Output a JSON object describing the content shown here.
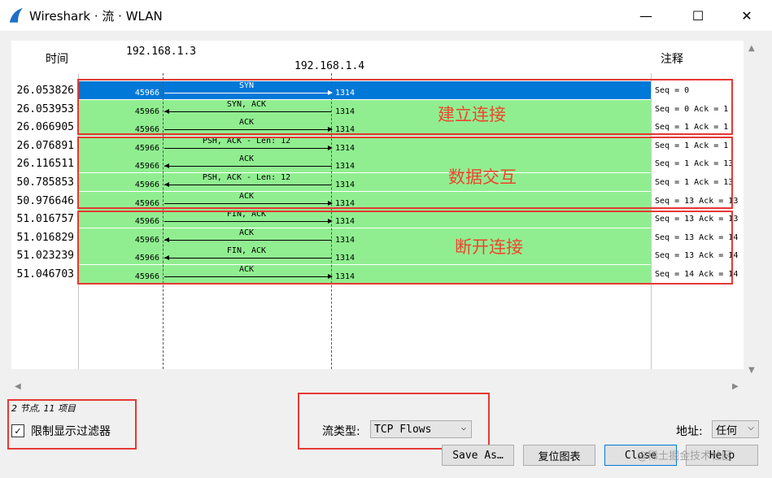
{
  "window": {
    "title": "Wireshark · 流 · WLAN",
    "minimize_glyph": "—",
    "maximize_glyph": "☐",
    "close_glyph": "✕"
  },
  "graph": {
    "time_header": "时间",
    "comment_header": "注释",
    "host_a": "192.168.1.3",
    "host_b": "192.168.1.4",
    "rows": [
      {
        "time": "26.053826",
        "port_a": "45966",
        "port_b": "1314",
        "label": "SYN",
        "dir": "right",
        "comment": "Seq = 0",
        "selected": true
      },
      {
        "time": "26.053953",
        "port_a": "45966",
        "port_b": "1314",
        "label": "SYN, ACK",
        "dir": "left",
        "comment": "Seq = 0 Ack = 1"
      },
      {
        "time": "26.066905",
        "port_a": "45966",
        "port_b": "1314",
        "label": "ACK",
        "dir": "right",
        "comment": "Seq = 1 Ack = 1"
      },
      {
        "time": "26.076891",
        "port_a": "45966",
        "port_b": "1314",
        "label": "PSH, ACK - Len: 12",
        "dir": "right",
        "comment": "Seq = 1 Ack = 1"
      },
      {
        "time": "26.116511",
        "port_a": "45966",
        "port_b": "1314",
        "label": "ACK",
        "dir": "left",
        "comment": "Seq = 1 Ack = 13"
      },
      {
        "time": "50.785853",
        "port_a": "45966",
        "port_b": "1314",
        "label": "PSH, ACK - Len: 12",
        "dir": "left",
        "comment": "Seq = 1 Ack = 13"
      },
      {
        "time": "50.976646",
        "port_a": "45966",
        "port_b": "1314",
        "label": "ACK",
        "dir": "right",
        "comment": "Seq = 13 Ack = 13"
      },
      {
        "time": "51.016757",
        "port_a": "45966",
        "port_b": "1314",
        "label": "FIN, ACK",
        "dir": "right",
        "comment": "Seq = 13 Ack = 13"
      },
      {
        "time": "51.016829",
        "port_a": "45966",
        "port_b": "1314",
        "label": "ACK",
        "dir": "left",
        "comment": "Seq = 13 Ack = 14"
      },
      {
        "time": "51.023239",
        "port_a": "45966",
        "port_b": "1314",
        "label": "FIN, ACK",
        "dir": "left",
        "comment": "Seq = 13 Ack = 14"
      },
      {
        "time": "51.046703",
        "port_a": "45966",
        "port_b": "1314",
        "label": "ACK",
        "dir": "right",
        "comment": "Seq = 14 Ack = 14"
      }
    ],
    "annotations": {
      "connect": "建立连接",
      "data": "数据交互",
      "disconnect": "断开连接"
    }
  },
  "status": {
    "summary": "2 节点, 11 项目",
    "limit_filter_label": "限制显示过滤器",
    "limit_filter_checked": true
  },
  "controls": {
    "flow_type_label": "流类型:",
    "flow_type_value": "TCP Flows",
    "address_label": "地址:",
    "address_value": "任何"
  },
  "buttons": {
    "save_as": "Save As…",
    "reset": "复位图表",
    "close": "Close",
    "help": "Help"
  },
  "watermark": "@稀土掘金技术社区",
  "colors": {
    "row_green": "#90ee90",
    "row_selected": "#0078d7",
    "annotation_red": "#e53935"
  }
}
